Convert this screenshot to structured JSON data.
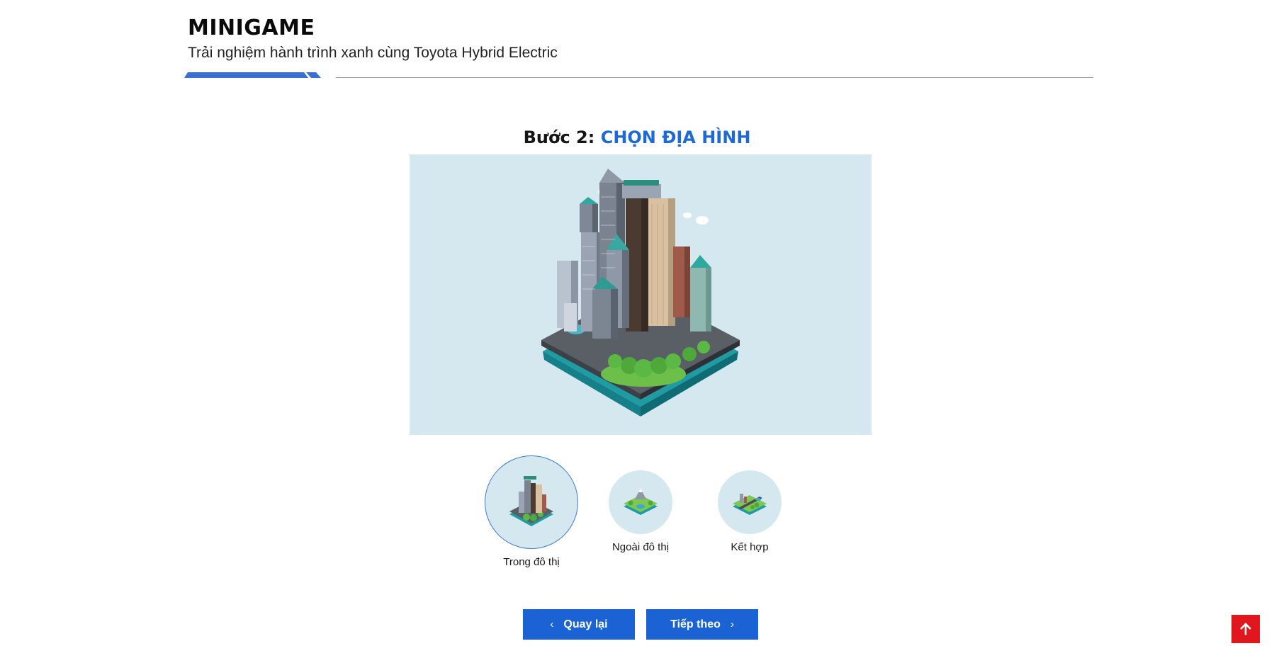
{
  "header": {
    "title": "MINIGAME",
    "subtitle": "Trải nghiệm hành trình xanh cùng Toyota Hybrid Electric"
  },
  "step": {
    "number": "Bước 2:",
    "name": "CHỌN ĐỊA HÌNH"
  },
  "hero": {
    "selected_terrain": "Trong đô thị"
  },
  "options": [
    {
      "label": "Trong đô thị",
      "selected": true
    },
    {
      "label": "Ngoài đô thị",
      "selected": false
    },
    {
      "label": "Kết hợp",
      "selected": false
    }
  ],
  "buttons": {
    "back": "Quay lại",
    "next": "Tiếp theo"
  },
  "icons": {
    "back": "chevron-left-icon",
    "next": "chevron-right-icon",
    "scroll_top": "arrow-up-icon"
  },
  "colors": {
    "accent": "#1d6ad7",
    "button": "#1b63d4",
    "panel": "#d5e8f0",
    "scroll_top": "#e0171f"
  }
}
